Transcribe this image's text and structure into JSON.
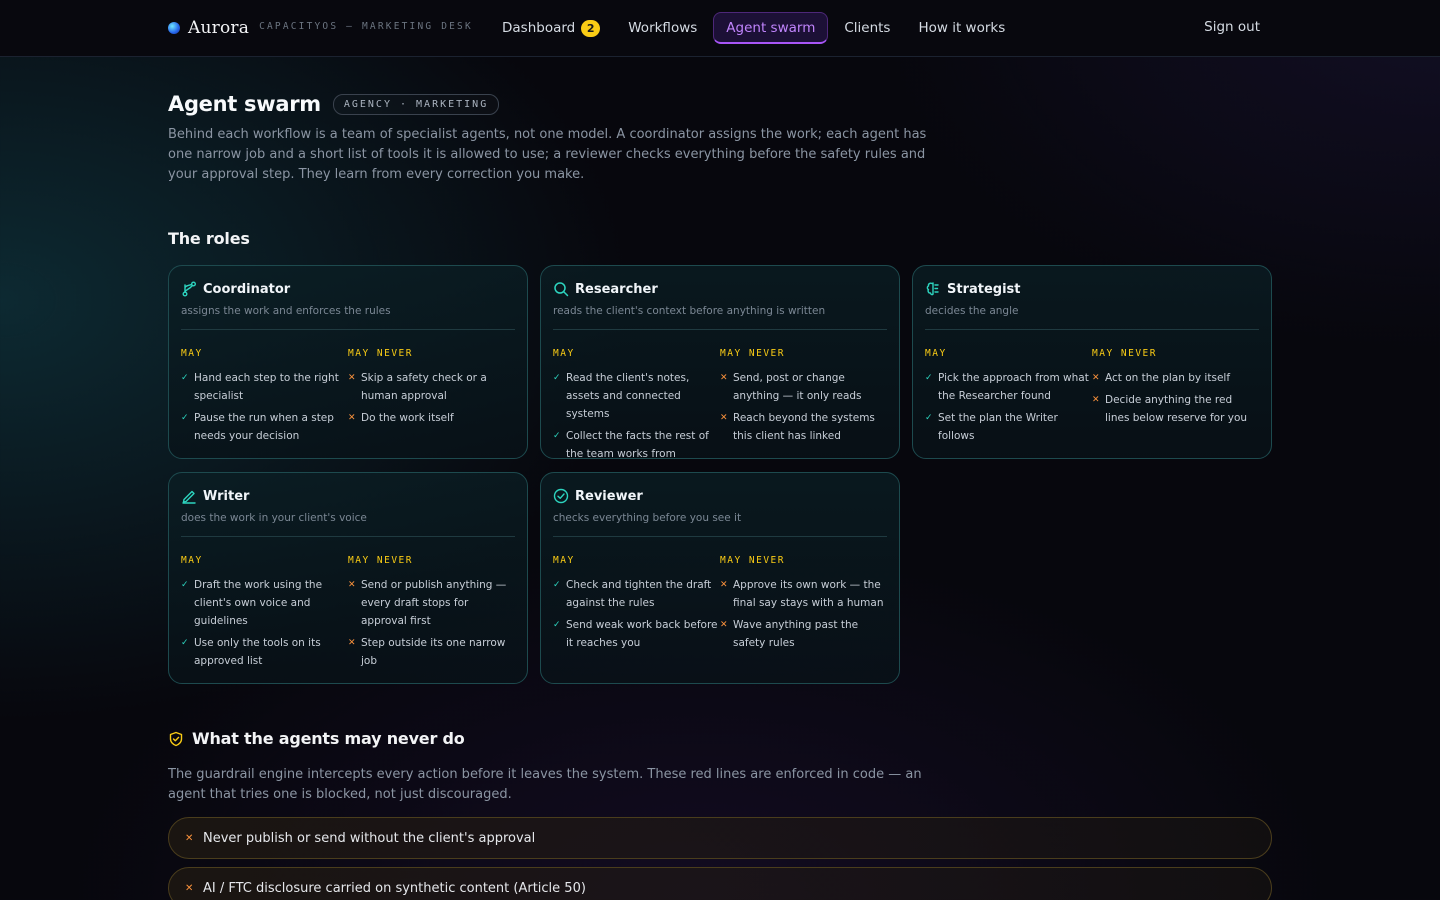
{
  "brand": {
    "name": "Aurora",
    "subtitle": "CAPACITYOS — MARKETING DESK"
  },
  "nav": {
    "items": [
      {
        "label": "Dashboard",
        "badge": "2"
      },
      {
        "label": "Workflows"
      },
      {
        "label": "Agent swarm",
        "active": true
      },
      {
        "label": "Clients"
      },
      {
        "label": "How it works"
      }
    ],
    "signout": "Sign out"
  },
  "header": {
    "title": "Agent swarm",
    "tag": "AGENCY · MARKETING",
    "intro": "Behind each workflow is a team of specialist agents, not one model. A coordinator assigns the work; each agent has one narrow job and a short list of tools it is allowed to use; a reviewer checks everything before the safety rules and your approval step. They learn from every correction you make."
  },
  "roles": {
    "title": "The roles",
    "may_label": "MAY",
    "never_label": "MAY NEVER",
    "items": [
      {
        "icon": "route-icon",
        "name": "Coordinator",
        "desc": "assigns the work and enforces the rules",
        "may": [
          "Hand each step to the right specialist",
          "Pause the run when a step needs your decision"
        ],
        "never": [
          "Skip a safety check or a human approval",
          "Do the work itself"
        ]
      },
      {
        "icon": "search-icon",
        "name": "Researcher",
        "desc": "reads the client's context before anything is written",
        "may": [
          "Read the client's notes, assets and connected systems",
          "Collect the facts the rest of the team works from"
        ],
        "never": [
          "Send, post or change anything — it only reads",
          "Reach beyond the systems this client has linked"
        ]
      },
      {
        "icon": "brain-icon",
        "name": "Strategist",
        "desc": "decides the angle",
        "may": [
          "Pick the approach from what the Researcher found",
          "Set the plan the Writer follows"
        ],
        "never": [
          "Act on the plan by itself",
          "Decide anything the red lines below reserve for you"
        ]
      },
      {
        "icon": "pen-icon",
        "name": "Writer",
        "desc": "does the work in your client's voice",
        "may": [
          "Draft the work using the client's own voice and guidelines",
          "Use only the tools on its approved list"
        ],
        "never": [
          "Send or publish anything — every draft stops for approval first",
          "Step outside its one narrow job"
        ]
      },
      {
        "icon": "check-circle-icon",
        "name": "Reviewer",
        "desc": "checks everything before you see it",
        "may": [
          "Check and tighten the draft against the rules",
          "Send weak work back before it reaches you"
        ],
        "never": [
          "Approve its own work — the final say stays with a human",
          "Wave anything past the safety rules"
        ]
      }
    ]
  },
  "never": {
    "title": "What the agents may never do",
    "intro": "The guardrail engine intercepts every action before it leaves the system. These red lines are enforced in code — an agent that tries one is blocked, not just discouraged.",
    "items": [
      "Never publish or send without the client's approval",
      "AI / FTC disclosure carried on synthetic content (Article 50)"
    ]
  },
  "colors": {
    "accent": "#a855f7",
    "teal": "#2dd4bf",
    "warning": "#facc15",
    "danger": "#fb923c"
  }
}
